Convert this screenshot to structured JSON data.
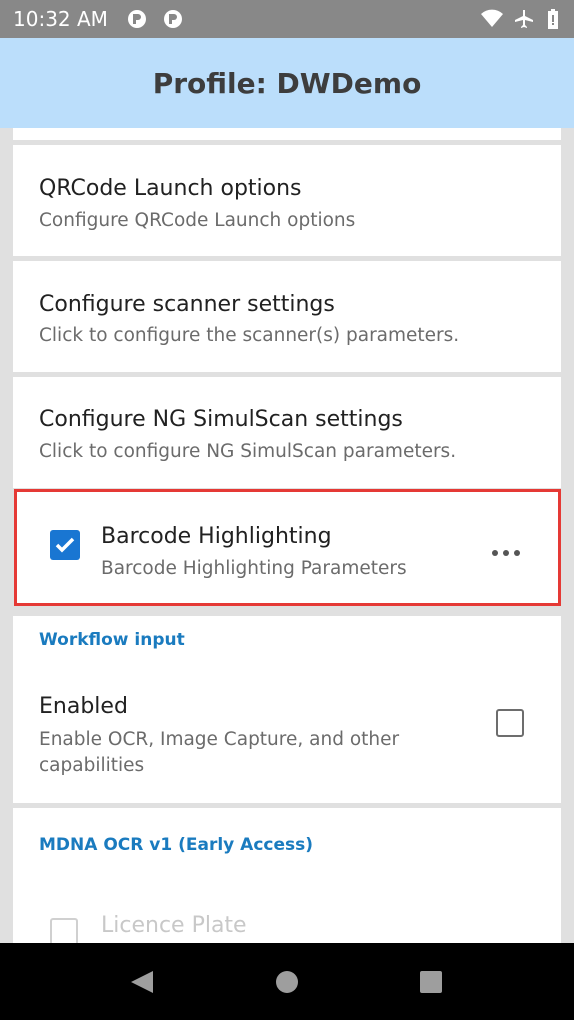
{
  "status_bar": {
    "time": "10:32 AM"
  },
  "app_bar": {
    "title": "Profile: DWDemo"
  },
  "items": [
    {
      "title": "QRCode Launch options",
      "subtitle": "Configure QRCode Launch options"
    },
    {
      "title": "Configure scanner settings",
      "subtitle": "Click to configure the scanner(s) parameters."
    },
    {
      "title": "Configure NG SimulScan settings",
      "subtitle": "Click to configure NG SimulScan parameters."
    }
  ],
  "barcode_highlighting": {
    "title": "Barcode Highlighting",
    "subtitle": "Barcode Highlighting Parameters",
    "checked": true
  },
  "workflow_input": {
    "header": "Workflow input",
    "enabled_title": "Enabled",
    "enabled_subtitle_line1": "Enable OCR, Image Capture, and other",
    "enabled_subtitle_line2": "capabilities",
    "checked": false
  },
  "mdna_ocr": {
    "header": "MDNA OCR v1 (Early Access)",
    "licence_plate": "Licence Plate"
  },
  "colors": {
    "accent": "#1976d2",
    "section_header": "#1a7bbf",
    "app_bar": "#bbdefb",
    "highlight_border": "#e53935"
  },
  "icons": [
    "notification-p-icon",
    "notification-p-icon",
    "wifi-icon",
    "airplane-icon",
    "battery-icon",
    "more-horiz-icon",
    "nav-back-icon",
    "nav-home-icon",
    "nav-recents-icon"
  ]
}
